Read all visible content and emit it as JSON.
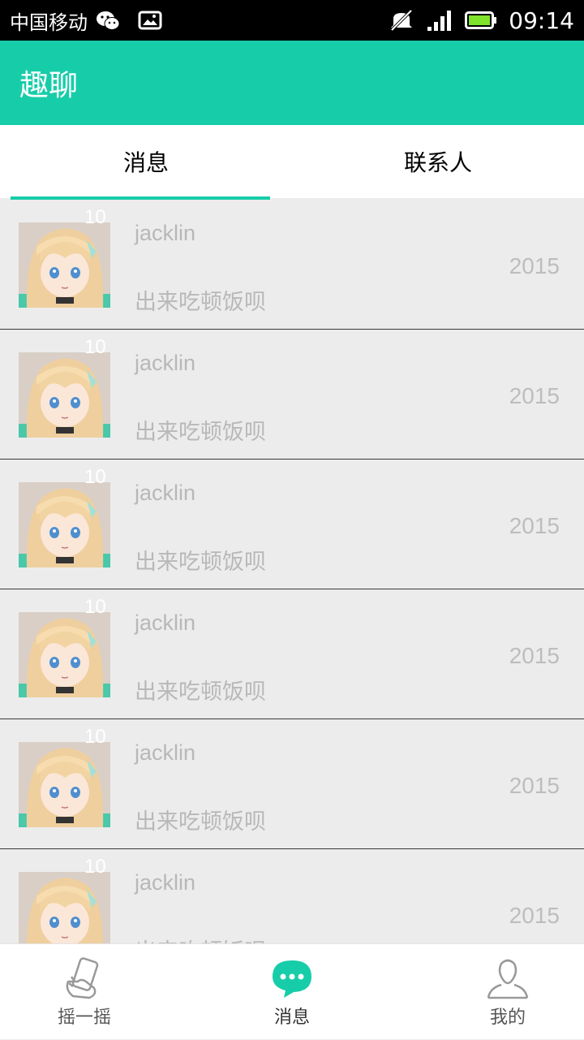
{
  "status_bar": {
    "carrier": "中国移动",
    "time": "09:14",
    "icons": [
      "wechat-icon",
      "image-icon",
      "mute-icon",
      "signal-icon",
      "battery-icon"
    ]
  },
  "app_bar": {
    "title": "趣聊"
  },
  "tabs": [
    {
      "label": "消息",
      "selected": true
    },
    {
      "label": "联系人",
      "selected": false
    }
  ],
  "conversations": [
    {
      "name": "jacklin",
      "message": "出来吃顿饭呗",
      "date": "2015",
      "badge": "10"
    },
    {
      "name": "jacklin",
      "message": "出来吃顿饭呗",
      "date": "2015",
      "badge": "10"
    },
    {
      "name": "jacklin",
      "message": "出来吃顿饭呗",
      "date": "2015",
      "badge": "10"
    },
    {
      "name": "jacklin",
      "message": "出来吃顿饭呗",
      "date": "2015",
      "badge": "10"
    },
    {
      "name": "jacklin",
      "message": "出来吃顿饭呗",
      "date": "2015",
      "badge": "10"
    },
    {
      "name": "jacklin",
      "message": "出来吃顿饭呗",
      "date": "2015",
      "badge": "10"
    }
  ],
  "bottom_nav": [
    {
      "label": "摇一摇",
      "icon": "shake-phone-icon",
      "active": false
    },
    {
      "label": "消息",
      "icon": "chat-bubble-icon",
      "active": true
    },
    {
      "label": "我的",
      "icon": "person-icon",
      "active": false
    }
  ],
  "colors": {
    "accent": "#17cda9",
    "list_bg": "#ececec",
    "muted_text": "#b8b8b8"
  }
}
